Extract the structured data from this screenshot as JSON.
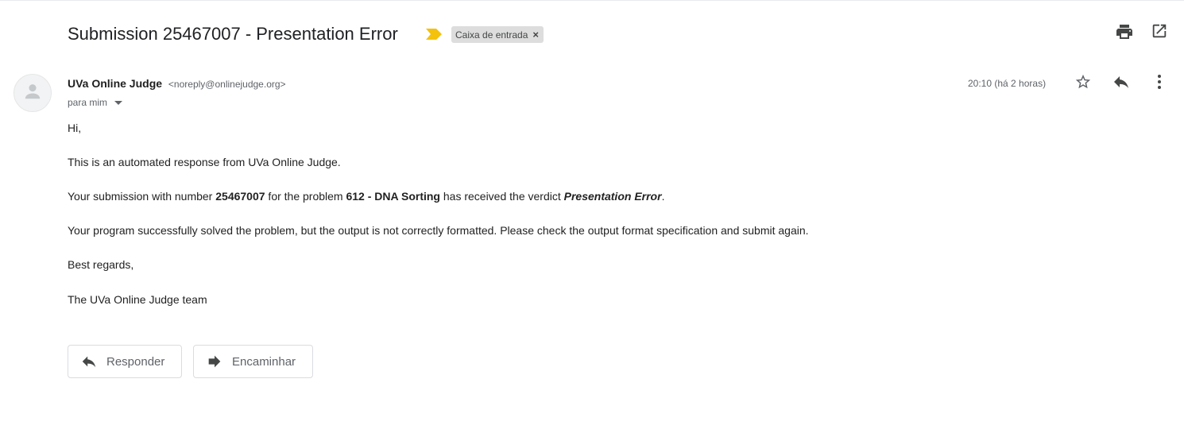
{
  "email": {
    "subject": "Submission 25467007 - Presentation Error",
    "label": "Caixa de entrada",
    "sender_name": "UVa Online Judge",
    "sender_email": "<noreply@onlinejudge.org>",
    "recipient": "para mim",
    "timestamp": "20:10 (há 2 horas)",
    "body": {
      "greeting": "Hi,",
      "intro": "This is an automated response from UVa Online Judge.",
      "verdict_pre": "Your submission with number ",
      "submission_number": "25467007",
      "verdict_mid": " for the problem ",
      "problem": "612 - DNA Sorting",
      "verdict_post": " has received the verdict ",
      "verdict": "Presentation Error",
      "verdict_end": ".",
      "explanation": "Your program successfully solved the problem, but the output is not correctly formatted. Please check the output format specification and submit again.",
      "closing": "Best regards,",
      "signature": "The UVa Online Judge team"
    }
  },
  "actions": {
    "reply_label": "Responder",
    "forward_label": "Encaminhar"
  },
  "icons": {
    "importance": "importance-marker-icon",
    "label_remove": "close-icon",
    "print": "print-icon",
    "popout": "open-in-new-window-icon",
    "avatar": "person-icon",
    "dropdown": "caret-down-icon",
    "star": "star-outline-icon",
    "reply": "reply-icon",
    "more": "more-vertical-icon",
    "forward": "forward-icon"
  },
  "colors": {
    "importance_marker": "#f4c20d",
    "label_chip_bg": "#dddddd",
    "icon_gray": "#5f6368"
  }
}
